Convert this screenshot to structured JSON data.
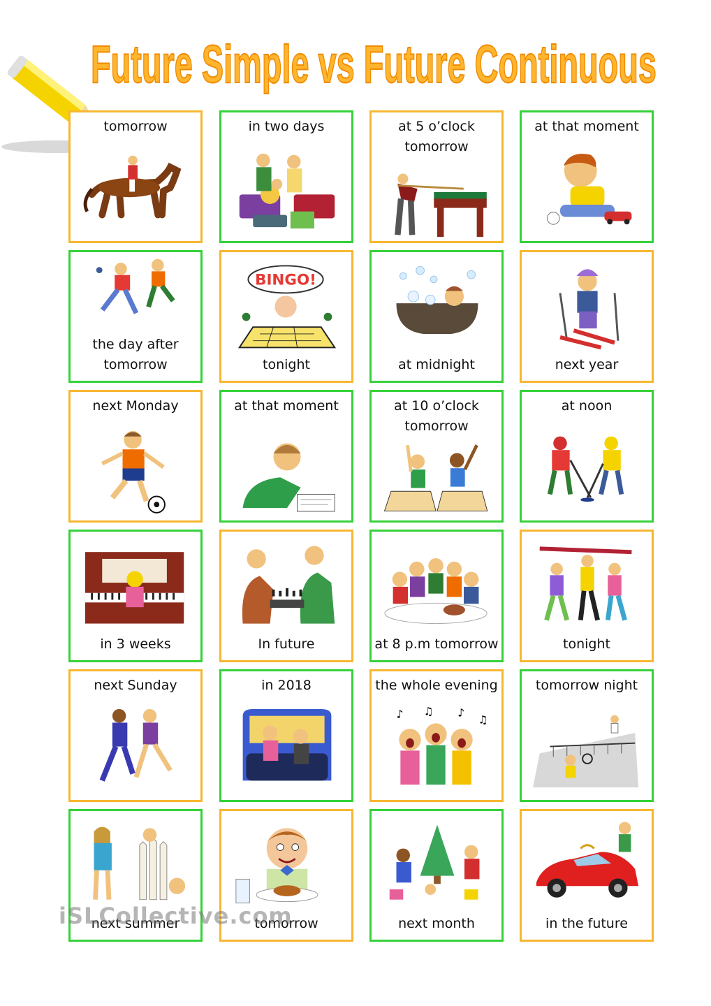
{
  "title": "Future Simple vs Future Continuous",
  "watermark": "iSLCollective.com",
  "colors": {
    "orange": "#f7b731",
    "green": "#35d23a",
    "title": "#ffb52e"
  },
  "cards": [
    {
      "label": "tomorrow",
      "pos": "top",
      "border": "orange",
      "icon": "horse-rider-icon"
    },
    {
      "label": "in two days",
      "pos": "top",
      "border": "green",
      "icon": "family-luggage-icon"
    },
    {
      "label": "at 5 o’clock\ntomorrow",
      "pos": "top",
      "border": "orange",
      "icon": "billiards-icon"
    },
    {
      "label": "at that moment",
      "pos": "top",
      "border": "green",
      "icon": "boy-toy-car-icon"
    },
    {
      "label": "the day after\ntomorrow",
      "pos": "bottom",
      "border": "green",
      "icon": "running-kids-icon"
    },
    {
      "label": "tonight",
      "pos": "bottom",
      "border": "orange",
      "icon": "bingo-icon"
    },
    {
      "label": "at midnight",
      "pos": "bottom",
      "border": "green",
      "icon": "bathtub-icon"
    },
    {
      "label": "next year",
      "pos": "bottom",
      "border": "orange",
      "icon": "skier-icon"
    },
    {
      "label": "next Monday",
      "pos": "top",
      "border": "orange",
      "icon": "soccer-boy-icon"
    },
    {
      "label": "at that moment",
      "pos": "top",
      "border": "green",
      "icon": "boy-writing-icon"
    },
    {
      "label": "at 10 o’clock\ntomorrow",
      "pos": "top",
      "border": "green",
      "icon": "classroom-icon"
    },
    {
      "label": "at noon",
      "pos": "top",
      "border": "green",
      "icon": "hockey-icon"
    },
    {
      "label": "in 3 weeks",
      "pos": "bottom",
      "border": "green",
      "icon": "piano-icon"
    },
    {
      "label": "In future",
      "pos": "bottom",
      "border": "orange",
      "icon": "chess-icon"
    },
    {
      "label": "at 8 p.m tomorrow",
      "pos": "bottom",
      "border": "green",
      "icon": "family-dinner-icon"
    },
    {
      "label": "tonight",
      "pos": "bottom",
      "border": "orange",
      "icon": "dancers-icon"
    },
    {
      "label": "next Sunday",
      "pos": "top",
      "border": "orange",
      "icon": "joggers-icon"
    },
    {
      "label": "in 2018",
      "pos": "top",
      "border": "green",
      "icon": "train-passengers-icon"
    },
    {
      "label": "the whole evening",
      "pos": "top",
      "border": "orange",
      "icon": "singers-icon"
    },
    {
      "label": "tomorrow night",
      "pos": "top",
      "border": "green",
      "icon": "tennis-icon"
    },
    {
      "label": "next summer",
      "pos": "bottom",
      "border": "green",
      "icon": "girl-fence-icon"
    },
    {
      "label": "tomorrow",
      "pos": "bottom",
      "border": "orange",
      "icon": "boy-eating-icon"
    },
    {
      "label": "next month",
      "pos": "bottom",
      "border": "green",
      "icon": "christmas-party-icon"
    },
    {
      "label": "in the future",
      "pos": "bottom",
      "border": "orange",
      "icon": "sports-car-icon"
    }
  ]
}
